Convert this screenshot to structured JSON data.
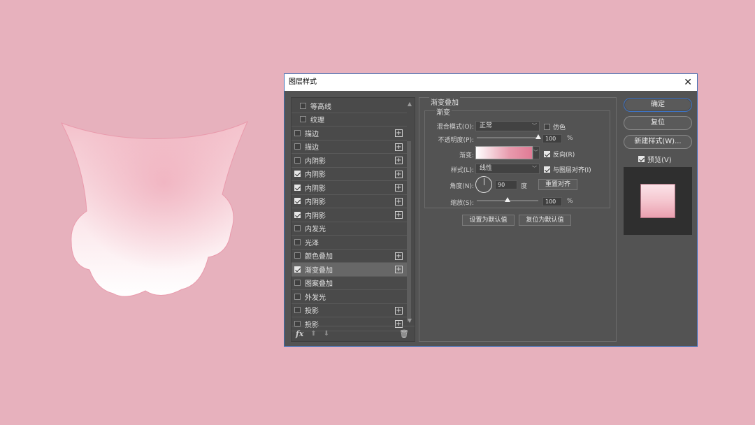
{
  "dialog": {
    "title": "图层样式",
    "close_icon": "close-icon"
  },
  "styles_list": [
    {
      "label": "等高线",
      "checked": false,
      "has_plus": false,
      "sub": true,
      "active": false
    },
    {
      "label": "纹理",
      "checked": false,
      "has_plus": false,
      "sub": true,
      "active": false
    },
    {
      "label": "描边",
      "checked": false,
      "has_plus": true,
      "sub": false,
      "active": false
    },
    {
      "label": "描边",
      "checked": false,
      "has_plus": true,
      "sub": false,
      "active": false
    },
    {
      "label": "内阴影",
      "checked": false,
      "has_plus": true,
      "sub": false,
      "active": false
    },
    {
      "label": "内阴影",
      "checked": true,
      "has_plus": true,
      "sub": false,
      "active": false
    },
    {
      "label": "内阴影",
      "checked": true,
      "has_plus": true,
      "sub": false,
      "active": false
    },
    {
      "label": "内阴影",
      "checked": true,
      "has_plus": true,
      "sub": false,
      "active": false
    },
    {
      "label": "内阴影",
      "checked": true,
      "has_plus": true,
      "sub": false,
      "active": false
    },
    {
      "label": "内发光",
      "checked": false,
      "has_plus": false,
      "sub": false,
      "active": false
    },
    {
      "label": "光泽",
      "checked": false,
      "has_plus": false,
      "sub": false,
      "active": false
    },
    {
      "label": "颜色叠加",
      "checked": false,
      "has_plus": true,
      "sub": false,
      "active": false
    },
    {
      "label": "渐变叠加",
      "checked": true,
      "has_plus": true,
      "sub": false,
      "active": true
    },
    {
      "label": "图案叠加",
      "checked": false,
      "has_plus": false,
      "sub": false,
      "active": false
    },
    {
      "label": "外发光",
      "checked": false,
      "has_plus": false,
      "sub": false,
      "active": false
    },
    {
      "label": "投影",
      "checked": false,
      "has_plus": true,
      "sub": false,
      "active": false
    },
    {
      "label": "投影",
      "checked": false,
      "has_plus": true,
      "sub": false,
      "active": false
    }
  ],
  "footer": {
    "fx_label": "fx",
    "up_icon": "arrow-up-icon",
    "down_icon": "arrow-down-icon",
    "trash_icon": "trash-icon"
  },
  "gradient_overlay": {
    "group_title": "渐变叠加",
    "sub_title": "渐变",
    "blend_mode_label": "混合模式(O):",
    "blend_mode_value": "正常",
    "dither_label": "仿色",
    "dither_checked": false,
    "opacity_label": "不透明度(P):",
    "opacity_value": "100",
    "opacity_unit": "%",
    "opacity_level": 1.0,
    "gradient_label": "渐变:",
    "gradient_colors": [
      "#ffffff",
      "#e89aad",
      "#e07b95"
    ],
    "reverse_label": "反向(R)",
    "reverse_checked": true,
    "style_label": "样式(L):",
    "style_value": "线性",
    "align_label": "与图层对齐(I)",
    "align_checked": true,
    "angle_label": "角度(N):",
    "angle_value": "90",
    "angle_unit": "度",
    "reset_align_button": "重置对齐",
    "scale_label": "缩放(S):",
    "scale_value": "100",
    "scale_unit": "%",
    "scale_level": 0.5,
    "set_default_button": "设置为默认值",
    "reset_default_button": "复位为默认值"
  },
  "right_buttons": {
    "ok": "确定",
    "reset": "复位",
    "new_style": "新建样式(W)...",
    "preview_label": "预览(V)",
    "preview_checked": true
  },
  "colors": {
    "background": "#e7b1bd",
    "dialog_bg": "#535353",
    "accent_border": "#3e73c4"
  }
}
